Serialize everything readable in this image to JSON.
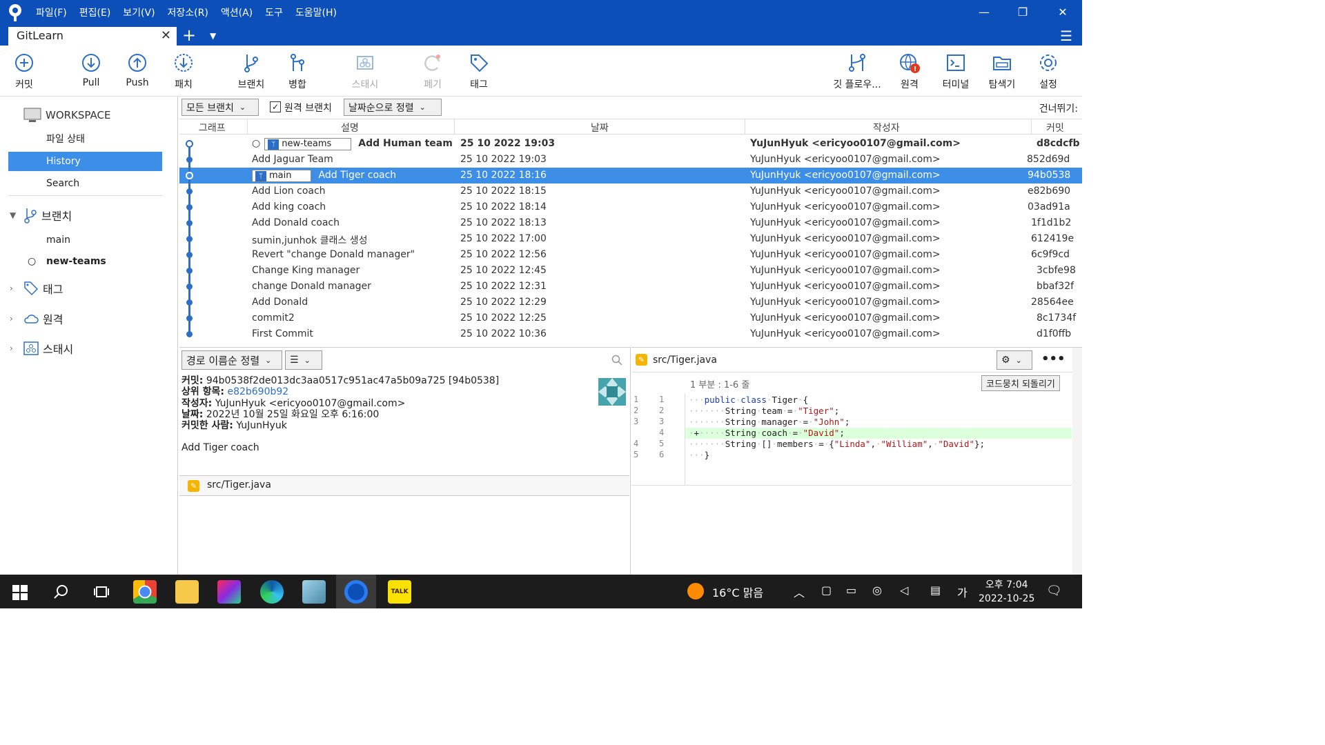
{
  "window": {
    "tab_title": "GitLearn"
  },
  "menu": [
    "파일(F)",
    "편집(E)",
    "보기(V)",
    "저장소(R)",
    "액션(A)",
    "도구",
    "도움말(H)"
  ],
  "toolbar": {
    "commit": "커밋",
    "pull": "Pull",
    "push": "Push",
    "patch": "패치",
    "branch": "브랜치",
    "merge": "병합",
    "stash": "스태시",
    "discard": "폐기",
    "tag": "태그",
    "gitflow": "깃 플로우...",
    "remote": "원격",
    "terminal": "터미널",
    "explorer": "탐색기",
    "settings": "설정"
  },
  "sidebar": {
    "workspace": "WORKSPACE",
    "file_status": "파일 상태",
    "history": "History",
    "search": "Search",
    "branches": "브랜치",
    "branch_items": [
      "main",
      "new-teams"
    ],
    "tags": "태그",
    "remotes": "원격",
    "stashes": "스태시"
  },
  "filter": {
    "branch_filter": "모든 브랜치",
    "remote_branch": "원격 브랜치",
    "sort": "날짜순으로 정렬",
    "skip": "건너뛰기:"
  },
  "columns": {
    "graph": "그래프",
    "desc": "설명",
    "date": "날짜",
    "author": "작성자",
    "commit": "커밋"
  },
  "commits": [
    {
      "branch": "new-teams",
      "desc": "Add Human team",
      "date": "25 10 2022 19:03",
      "author": "YuJunHyuk <ericyoo0107@gmail.com>",
      "hash": "d8cdcfb"
    },
    {
      "branch": "",
      "desc": "Add Jaguar Team",
      "date": "25 10 2022 19:03",
      "author": "YuJunHyuk <ericyoo0107@gmail.com>",
      "hash": "852d69d"
    },
    {
      "branch": "main",
      "desc": "Add Tiger coach",
      "date": "25 10 2022 18:16",
      "author": "YuJunHyuk <ericyoo0107@gmail.com>",
      "hash": "94b0538"
    },
    {
      "branch": "",
      "desc": "Add Lion coach",
      "date": "25 10 2022 18:15",
      "author": "YuJunHyuk <ericyoo0107@gmail.com>",
      "hash": "e82b690"
    },
    {
      "branch": "",
      "desc": "Add king coach",
      "date": "25 10 2022 18:14",
      "author": "YuJunHyuk <ericyoo0107@gmail.com>",
      "hash": "03ad91a"
    },
    {
      "branch": "",
      "desc": "Add Donald coach",
      "date": "25 10 2022 18:13",
      "author": "YuJunHyuk <ericyoo0107@gmail.com>",
      "hash": "1f1d1b2"
    },
    {
      "branch": "",
      "desc": "sumin,junhok 클래스 생성",
      "date": "25 10 2022 17:00",
      "author": "YuJunHyuk <ericyoo0107@gmail.com>",
      "hash": "612419e"
    },
    {
      "branch": "",
      "desc": "Revert \"change Donald manager\"",
      "date": "25 10 2022 12:56",
      "author": "YuJunHyuk <ericyoo0107@gmail.com>",
      "hash": "6c9f9cd"
    },
    {
      "branch": "",
      "desc": "Change King manager",
      "date": "25 10 2022 12:45",
      "author": "YuJunHyuk <ericyoo0107@gmail.com>",
      "hash": "3cbfe98"
    },
    {
      "branch": "",
      "desc": "change Donald manager",
      "date": "25 10 2022 12:31",
      "author": "YuJunHyuk <ericyoo0107@gmail.com>",
      "hash": "bbaf32f"
    },
    {
      "branch": "",
      "desc": "Add Donald",
      "date": "25 10 2022 12:29",
      "author": "YuJunHyuk <ericyoo0107@gmail.com>",
      "hash": "28564ee"
    },
    {
      "branch": "",
      "desc": "commit2",
      "date": "25 10 2022 12:25",
      "author": "YuJunHyuk <ericyoo0107@gmail.com>",
      "hash": "8c1734f"
    },
    {
      "branch": "",
      "desc": "First Commit",
      "date": "25 10 2022 10:36",
      "author": "YuJunHyuk <ericyoo0107@gmail.com>",
      "hash": "d1f0ffb"
    }
  ],
  "details": {
    "sort": "경로 이름순 정렬",
    "commit_label": "커밋:",
    "commit_value": "94b0538f2de013dc3aa0517c951ac47a5b09a725 [94b0538]",
    "parent_label": "상위 항목:",
    "parent_value": "e82b690b92",
    "author_label": "작성자:",
    "author_value": "YuJunHyuk <ericyoo0107@gmail.com>",
    "date_label": "날짜:",
    "date_value": "2022년 10월 25일 화요일 오후 6:16:00",
    "committer_label": "커밋한 사람:",
    "committer_value": "YuJunHyuk",
    "message": "Add Tiger coach",
    "file": "src/Tiger.java"
  },
  "diff": {
    "file": "src/Tiger.java",
    "hunk": "1 부분 : 1-6 줄",
    "revert": "코드뭉치 되돌리기",
    "old_nums": [
      "1",
      "2",
      "3",
      "",
      "4",
      "5"
    ],
    "new_nums": [
      "1",
      "2",
      "3",
      "4",
      "5",
      "6"
    ]
  },
  "taskbar": {
    "weather": "16°C 맑음",
    "time": "오후 7:04",
    "date": "2022-10-25",
    "ime": "가"
  }
}
